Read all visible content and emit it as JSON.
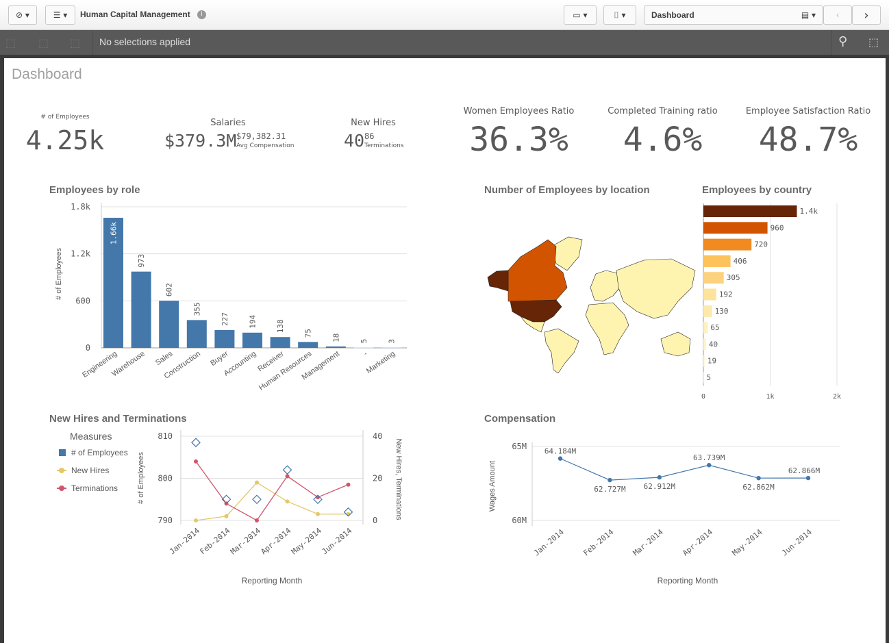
{
  "app": {
    "title": "Human Capital Management",
    "sheet_selector": "Dashboard",
    "selections_text": "No selections applied"
  },
  "icons": {
    "nav": "compass-icon",
    "menu": "list-icon",
    "info": "info-icon",
    "present": "presentation-icon",
    "bookmark": "bookmark-icon",
    "sheets": "sheets-icon",
    "prev": "chevron-left-icon",
    "next": "chevron-right-icon",
    "search": "search-icon",
    "select": "selection-tool-icon"
  },
  "sheet": {
    "title": "Dashboard"
  },
  "kpis": {
    "employees": {
      "label": "# of Employees",
      "value": "4.25k"
    },
    "salaries": {
      "label": "Salaries",
      "value": "$379.3M",
      "sub_value": "$79,382.31",
      "sub_label": "Avg Compensation"
    },
    "new_hires": {
      "label": "New Hires",
      "value": "40",
      "sub_value": "86",
      "sub_label": "Terminations"
    },
    "women": {
      "label": "Women Employees Ratio",
      "value": "36.3%"
    },
    "training": {
      "label": "Completed Training ratio",
      "value": "4.6%"
    },
    "satisfaction": {
      "label": "Employee Satisfaction Ratio",
      "value": "48.7%"
    }
  },
  "colors": {
    "blue": "#4477aa",
    "hires": "#e3c86a",
    "terminations": "#d1566b",
    "map_us": "#662506",
    "map_ca": "#d35400",
    "map_other": "#fff3b0"
  },
  "chart_data": [
    {
      "id": "role",
      "type": "bar",
      "title": "Employees by role",
      "ylabel": "# of Employees",
      "ylim": [
        0,
        1800
      ],
      "ticks": [
        "0",
        "600",
        "1.2k",
        "1.8k"
      ],
      "tick_values": [
        0,
        600,
        1200,
        1800
      ],
      "categories": [
        "Engineering",
        "Warehouse",
        "Sales",
        "Construction",
        "Buyer",
        "Accounting",
        "Receiver",
        "Human Resources",
        "Management",
        "-",
        "Marketing"
      ],
      "values": [
        1660,
        973,
        602,
        355,
        227,
        194,
        138,
        75,
        18,
        5,
        3
      ],
      "labels": [
        "1.66k",
        "973",
        "602",
        "355",
        "227",
        "194",
        "138",
        "75",
        "18",
        "5",
        "3"
      ],
      "color": "#4477aa",
      "grid": true
    },
    {
      "id": "country",
      "type": "bar",
      "orientation": "horizontal",
      "title": "Employees by country",
      "xlim": [
        0,
        2000
      ],
      "ticks": [
        "0",
        "1k",
        "2k"
      ],
      "tick_values": [
        0,
        1000,
        2000
      ],
      "values": [
        1400,
        960,
        720,
        406,
        305,
        192,
        130,
        65,
        40,
        19,
        5
      ],
      "labels": [
        "1.4k",
        "960",
        "720",
        "406",
        "305",
        "192",
        "130",
        "65",
        "40",
        "19",
        "5"
      ],
      "colors": [
        "#662506",
        "#d35400",
        "#f28a22",
        "#fdc25a",
        "#fdd27f",
        "#fee39d",
        "#fee9ad",
        "#fff0c0",
        "#fff3c8",
        "#fff6d2",
        "#fff8da"
      ],
      "grid": true
    },
    {
      "id": "location",
      "type": "map",
      "title": "Number of Employees by location"
    },
    {
      "id": "hires",
      "type": "line",
      "title": "New Hires and Terminations",
      "legend_title": "Measures",
      "legend_position": "left",
      "xlabel": "Reporting Month",
      "ylabel": "# of Employees",
      "ylabel_right": "New Hires, Terminations",
      "categories": [
        "Jan-2014",
        "Feb-2014",
        "Mar-2014",
        "Apr-2014",
        "May-2014",
        "Jun-2014"
      ],
      "ylim": [
        790,
        810
      ],
      "yticks": [
        "790",
        "800",
        "810"
      ],
      "ylim_right": [
        0,
        40
      ],
      "yticks_right": [
        "0",
        "20",
        "40"
      ],
      "series": [
        {
          "name": "# of Employees",
          "axis": "left",
          "marker": "diamond",
          "values": [
            808.5,
            795,
            795,
            802,
            795,
            792
          ],
          "color": "#4477aa"
        },
        {
          "name": "New Hires",
          "axis": "right",
          "values": [
            0,
            2,
            18,
            9,
            3,
            3
          ],
          "color": "#e3c86a"
        },
        {
          "name": "Terminations",
          "axis": "right",
          "values": [
            28,
            8,
            0,
            21,
            11,
            17
          ],
          "color": "#d1566b"
        }
      ],
      "grid": true
    },
    {
      "id": "comp",
      "type": "line",
      "title": "Compensation",
      "xlabel": "Reporting Month",
      "ylabel": "Wages Amount",
      "categories": [
        "Jan-2014",
        "Feb-2014",
        "Mar-2014",
        "Apr-2014",
        "May-2014",
        "Jun-2014"
      ],
      "ylim": [
        60,
        65
      ],
      "yticks": [
        "60M",
        "65M"
      ],
      "values": [
        64.184,
        62.727,
        62.912,
        63.739,
        62.862,
        62.866
      ],
      "labels": [
        "64.184M",
        "62.727M",
        "62.912M",
        "63.739M",
        "62.862M",
        "62.866M"
      ],
      "color": "#4477aa",
      "grid": true
    }
  ]
}
